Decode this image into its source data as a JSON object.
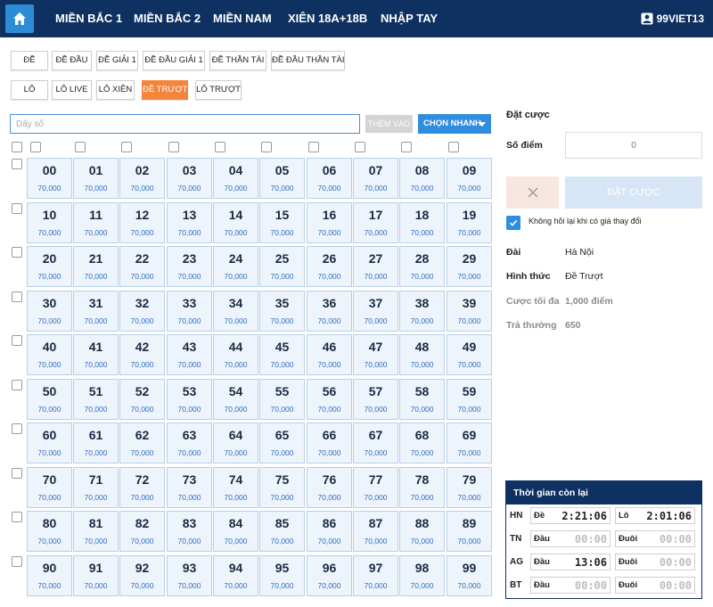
{
  "nav": {
    "items": [
      "MIỀN BẮC 1",
      "MIỀN BẮC 2",
      "MIỀN NAM",
      "XIÊN 18A+18B",
      "NHẬP TAY"
    ],
    "username": "99VIET13"
  },
  "tabs_row1": [
    "ĐỀ",
    "ĐỀ ĐẦU",
    "ĐỀ GIẢI 1",
    "ĐỀ ĐẦU GIẢI 1",
    "ĐỀ THẦN TÀI",
    "ĐỀ ĐẦU THẦN TÀI"
  ],
  "tabs_row2": [
    "LÔ",
    "LÔ LIVE",
    "LÔ XIÊN",
    "ĐỀ TRƯỢT",
    "LÔ TRƯỢT"
  ],
  "active_tab": "ĐỀ TRƯỢT",
  "search": {
    "placeholder": "Dãy số",
    "add_label": "THÊM VÀO",
    "quick_label": "CHỌN NHANH"
  },
  "grid": {
    "numbers": [
      "00",
      "01",
      "02",
      "03",
      "04",
      "05",
      "06",
      "07",
      "08",
      "09",
      "10",
      "11",
      "12",
      "13",
      "14",
      "15",
      "16",
      "17",
      "18",
      "19",
      "20",
      "21",
      "22",
      "23",
      "24",
      "25",
      "26",
      "27",
      "28",
      "29",
      "30",
      "31",
      "32",
      "33",
      "34",
      "35",
      "36",
      "37",
      "38",
      "39",
      "40",
      "41",
      "42",
      "43",
      "44",
      "45",
      "46",
      "47",
      "48",
      "49",
      "50",
      "51",
      "52",
      "53",
      "54",
      "55",
      "56",
      "57",
      "58",
      "59",
      "60",
      "61",
      "62",
      "63",
      "64",
      "65",
      "66",
      "67",
      "68",
      "69",
      "70",
      "71",
      "72",
      "73",
      "74",
      "75",
      "76",
      "77",
      "78",
      "79",
      "80",
      "81",
      "82",
      "83",
      "84",
      "85",
      "86",
      "87",
      "88",
      "89",
      "90",
      "91",
      "92",
      "93",
      "94",
      "95",
      "96",
      "97",
      "98",
      "99"
    ],
    "price": "70,000"
  },
  "bet": {
    "title": "Đặt cược",
    "points_label": "Số điểm",
    "points_placeholder": "0",
    "place_label": "ĐẶT CƯỢC",
    "no_ask_label": "Không hỏi lại khi có giá thay đổi",
    "station_label": "Đài",
    "station_value": "Hà Nội",
    "type_label": "Hình thức",
    "type_value": "Đề Trượt",
    "max_label": "Cược tối đa",
    "max_value": "1,000 điểm",
    "payout_label": "Trả thưởng",
    "payout_value": "650"
  },
  "timer": {
    "title": "Thời gian còn lại",
    "rows": [
      {
        "code": "HN",
        "left_label": "Đề",
        "left_value": "2:21:06",
        "right_label": "Lô",
        "right_value": "2:01:06"
      },
      {
        "code": "TN",
        "left_label": "Đầu",
        "left_value": "00:00",
        "right_label": "Đuôi",
        "right_value": "00:00"
      },
      {
        "code": "AG",
        "left_label": "Đầu",
        "left_value": "13:06",
        "right_label": "Đuôi",
        "right_value": "00:00"
      },
      {
        "code": "BT",
        "left_label": "Đầu",
        "left_value": "00:00",
        "right_label": "Đuôi",
        "right_value": "00:00"
      }
    ]
  },
  "colors": {
    "nav_bg": "#0e3161",
    "accent_blue": "#2f8de0",
    "active_orange": "#f4853a"
  }
}
